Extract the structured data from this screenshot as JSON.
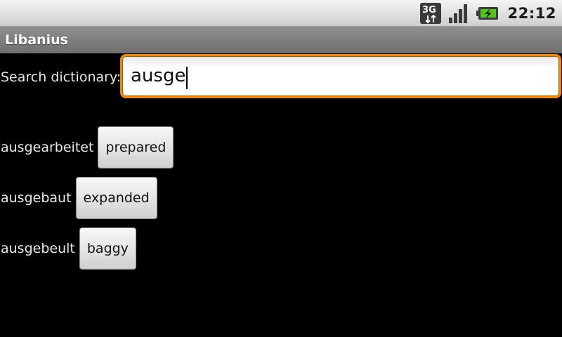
{
  "status_bar": {
    "network_type": "3G",
    "network_icon": "3g-data-icon",
    "signal_icon": "signal-strength-icon",
    "battery_icon": "battery-charging-icon",
    "time": "22:12"
  },
  "app": {
    "title": "Libanius"
  },
  "search": {
    "label": "Search dictionary:",
    "value": "ausge",
    "accent_color": "#f08a00"
  },
  "results": [
    {
      "word": "ausgearbeitet",
      "translation": "prepared"
    },
    {
      "word": "ausgebaut",
      "translation": "expanded"
    },
    {
      "word": "ausgebeult",
      "translation": "baggy"
    }
  ]
}
